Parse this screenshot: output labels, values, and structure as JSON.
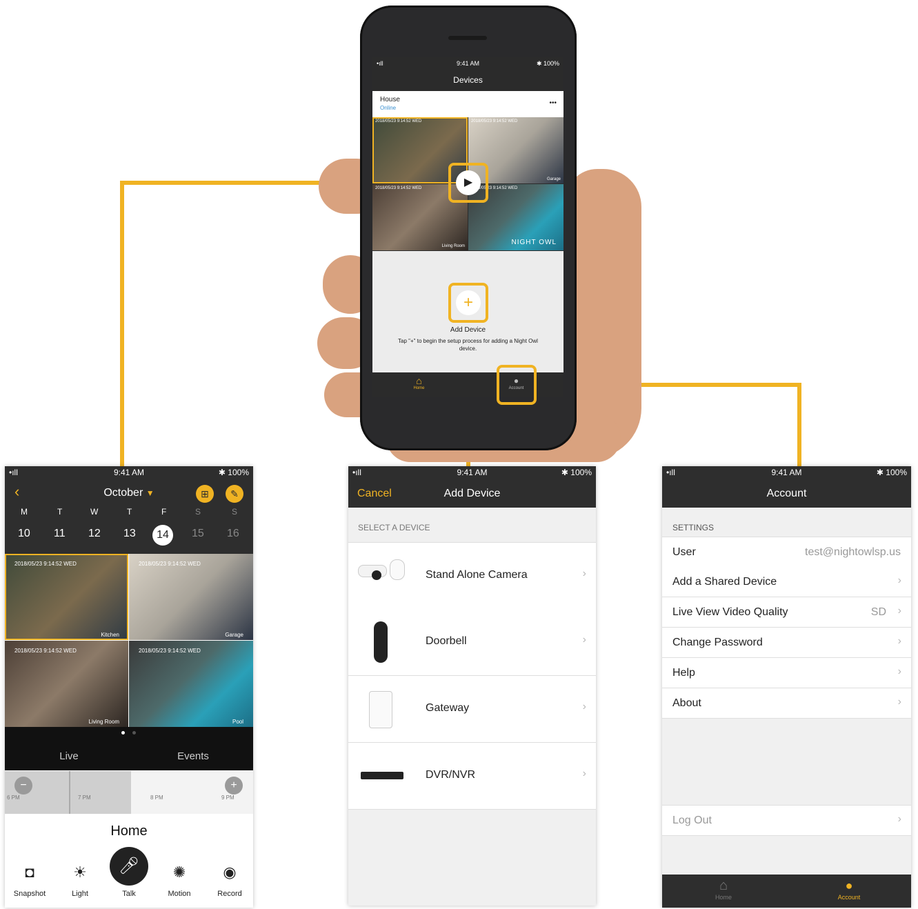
{
  "colors": {
    "accent": "#f0b323",
    "dark_bar": "#2e2e2e",
    "online": "#3a8fd0"
  },
  "phone": {
    "status": {
      "signal": "•ıll",
      "time": "9:41 AM",
      "battery": "✱ 100%"
    },
    "title": "Devices",
    "device": {
      "name": "House",
      "status": "Online",
      "more": "•••"
    },
    "cams": [
      {
        "ts": "2018/05/23 9:14:52 WED",
        "label": ""
      },
      {
        "ts": "2018/05/23 9:14:52 WED",
        "label": "Garage"
      },
      {
        "ts": "2018/05/23 9:14:52 WED",
        "label": "Living Room"
      },
      {
        "ts": "2018/05/23 9:14:52 WED",
        "label": ""
      }
    ],
    "brand": "NIGHT OWL",
    "add_title": "Add Device",
    "add_desc": "Tap \"+\" to begin the setup process for adding a Night Owl device.",
    "tabs": {
      "home": "Home",
      "account": "Account"
    }
  },
  "left": {
    "status": {
      "signal": "•ıll",
      "time": "9:41 AM",
      "battery": "✱ 100%"
    },
    "month": "October",
    "weekdays": [
      "M",
      "T",
      "W",
      "T",
      "F",
      "S",
      "S"
    ],
    "days": [
      "10",
      "11",
      "12",
      "13",
      "14",
      "15",
      "16"
    ],
    "selected_day": "14",
    "cams": [
      {
        "ts": "2018/05/23 9:14:52 WED",
        "label": "Kitchen"
      },
      {
        "ts": "2018/05/23 9:14:52 WED",
        "label": "Garage"
      },
      {
        "ts": "2018/05/23 9:14:52 WED",
        "label": "Living Room"
      },
      {
        "ts": "2018/05/23 9:14:52 WED",
        "label": "Pool"
      }
    ],
    "tabs": {
      "live": "Live",
      "events": "Events"
    },
    "timeline": [
      "6 PM",
      "7 PM",
      "8 PM",
      "9 PM"
    ],
    "zoom_out": "−",
    "zoom_in": "+",
    "location": "Home",
    "actions": [
      "Snapshot",
      "Light",
      "Talk",
      "Motion",
      "Record"
    ]
  },
  "middle": {
    "status": {
      "signal": "•ıll",
      "time": "9:41 AM",
      "battery": "✱ 100%"
    },
    "cancel": "Cancel",
    "title": "Add Device",
    "section": "SELECT A DEVICE",
    "devices": [
      "Stand Alone Camera",
      "Doorbell",
      "Gateway",
      "DVR/NVR"
    ]
  },
  "right": {
    "status": {
      "signal": "•ıll",
      "time": "9:41 AM",
      "battery": "✱ 100%"
    },
    "title": "Account",
    "section": "SETTINGS",
    "rows": [
      {
        "label": "User",
        "value": "test@nightowlsp.us"
      },
      {
        "label": "Add a Shared Device",
        "value": ""
      },
      {
        "label": "Live View Video Quality",
        "value": "SD"
      },
      {
        "label": "Change Password",
        "value": ""
      },
      {
        "label": "Help",
        "value": ""
      },
      {
        "label": "About",
        "value": ""
      }
    ],
    "logout": "Log Out",
    "tabs": {
      "home": "Home",
      "account": "Account"
    }
  }
}
